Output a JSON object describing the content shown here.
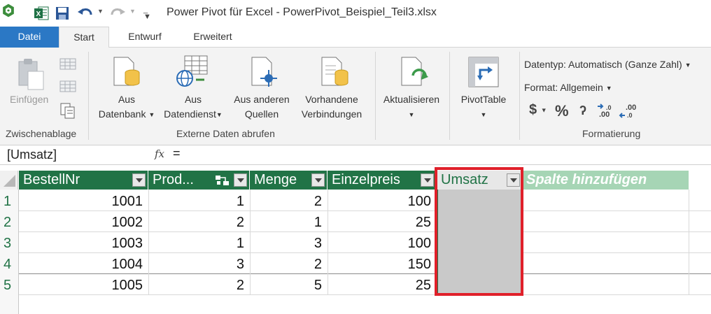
{
  "window": {
    "title": "Power Pivot für Excel - PowerPivot_Beispiel_Teil3.xlsx"
  },
  "tabs": [
    "Datei",
    "Start",
    "Entwurf",
    "Erweitert"
  ],
  "ribbon": {
    "einfuegen": "Einfügen",
    "zwischenablage": "Zwischenablage",
    "aus_datenbank_1": "Aus",
    "aus_datenbank_2": "Datenbank",
    "aus_datendienst_1": "Aus",
    "aus_datendienst_2": "Datendienst",
    "aus_anderen_1": "Aus anderen",
    "aus_anderen_2": "Quellen",
    "vorhandene_1": "Vorhandene",
    "vorhandene_2": "Verbindungen",
    "externe_daten": "Externe Daten abrufen",
    "aktualisieren": "Aktualisieren",
    "pivottable": "PivotTable",
    "datentyp": "Datentyp: Automatisch (Ganze Zahl)",
    "format": "Format: Allgemein",
    "formatierung": "Formatierung",
    "currency_symbol": "$",
    "percent_symbol": "%",
    "comma_symbol": "ʔ"
  },
  "formula_bar": {
    "name_box": "[Umsatz]",
    "fx": "fx",
    "formula": "="
  },
  "table": {
    "columns": [
      "BestellNr",
      "Prod...",
      "Menge",
      "Einzelpreis",
      "Umsatz",
      "Spalte hinzufügen"
    ],
    "rows": [
      {
        "num": "1",
        "bestellnr": "1001",
        "prod": "1",
        "menge": "2",
        "einzelpreis": "100"
      },
      {
        "num": "2",
        "bestellnr": "1002",
        "prod": "2",
        "menge": "1",
        "einzelpreis": "25"
      },
      {
        "num": "3",
        "bestellnr": "1003",
        "prod": "1",
        "menge": "3",
        "einzelpreis": "100"
      },
      {
        "num": "4",
        "bestellnr": "1004",
        "prod": "3",
        "menge": "2",
        "einzelpreis": "150"
      },
      {
        "num": "5",
        "bestellnr": "1005",
        "prod": "2",
        "menge": "5",
        "einzelpreis": "25"
      }
    ]
  },
  "colors": {
    "accent_green": "#217346",
    "highlight_red": "#e0202a",
    "tab_blue": "#2b78c5"
  }
}
